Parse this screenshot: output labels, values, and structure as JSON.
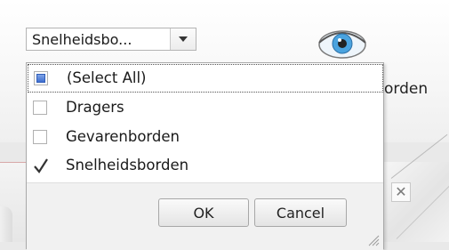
{
  "filter_combo": {
    "selected_value": "Snelheidsbo...",
    "arrow_icon": "dropdown-arrow-icon"
  },
  "background": {
    "ribbon_partial_label": "orden",
    "close_symbol": "✕"
  },
  "dropdown": {
    "items": [
      {
        "label": "(Select All)",
        "state": "indeterminate"
      },
      {
        "label": "Dragers",
        "state": "unchecked"
      },
      {
        "label": "Gevarenborden",
        "state": "unchecked"
      },
      {
        "label": "Snelheidsborden",
        "state": "checked"
      }
    ],
    "ok_label": "OK",
    "cancel_label": "Cancel"
  },
  "icons": {
    "visibility": "eye-icon",
    "resize": "resize-grip-icon"
  },
  "colors": {
    "accent_blue": "#3f6fd0",
    "eye_blue": "#4aa3df"
  }
}
